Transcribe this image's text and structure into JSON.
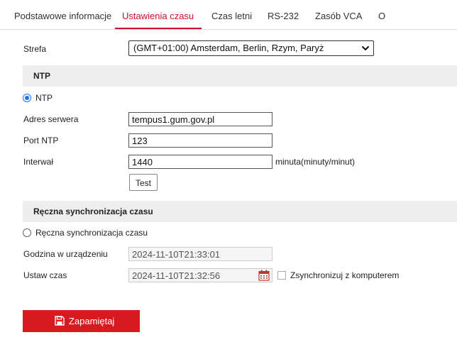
{
  "tabs": [
    {
      "label": "Podstawowe informacje",
      "active": false
    },
    {
      "label": "Ustawienia czasu",
      "active": true
    },
    {
      "label": "Czas letni",
      "active": false
    },
    {
      "label": "RS-232",
      "active": false
    },
    {
      "label": "Zasób VCA",
      "active": false
    },
    {
      "label": "O",
      "active": false
    }
  ],
  "timezone": {
    "label": "Strefa",
    "selected": "(GMT+01:00) Amsterdam, Berlin, Rzym, Paryż"
  },
  "ntp": {
    "section_title": "NTP",
    "radio_label": "NTP",
    "radio_checked": true,
    "server_label": "Adres serwera",
    "server_value": "tempus1.gum.gov.pl",
    "port_label": "Port NTP",
    "port_value": "123",
    "interval_label": "Interwał",
    "interval_value": "1440",
    "interval_unit": "minuta(minuty/minut)",
    "test_label": "Test"
  },
  "manual": {
    "section_title": "Ręczna synchronizacja czasu",
    "radio_label": "Ręczna synchronizacja czasu",
    "radio_checked": false,
    "device_time_label": "Godzina w urządzeniu",
    "device_time_value": "2024-11-10T21:33:01",
    "set_time_label": "Ustaw czas",
    "set_time_value": "2024-11-10T21:32:56",
    "sync_pc_label": "Zsynchronizuj z komputerem",
    "sync_pc_checked": false
  },
  "save": {
    "label": "Zapamiętaj"
  },
  "colors": {
    "accent": "#c8102e",
    "save_button": "#d71920",
    "radio_checked": "#1a73e8"
  },
  "icons": [
    "chevron-down-icon",
    "calendar-icon",
    "save-icon"
  ]
}
